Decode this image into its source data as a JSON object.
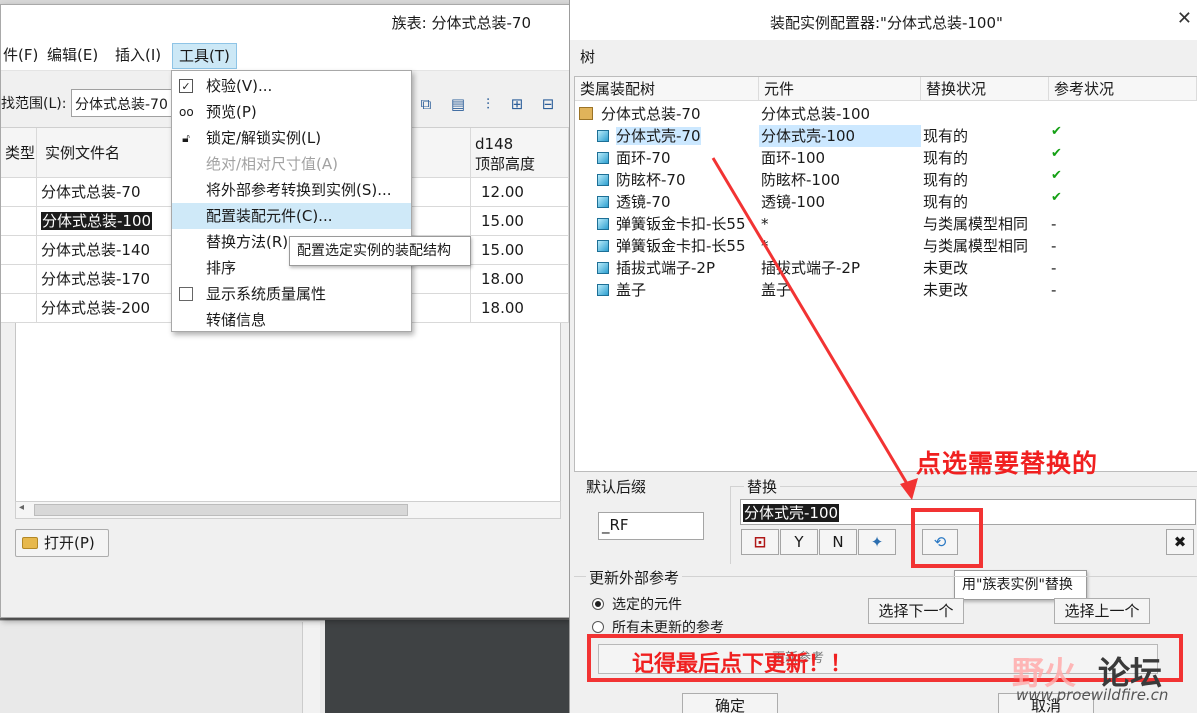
{
  "family_window": {
    "title": "族表: 分体式总装-70",
    "menu": [
      "件(F)",
      "编辑(E)",
      "插入(I)",
      "工具(T)"
    ],
    "scope_label": "找范围(L):",
    "scope_value": "分体式总装-70",
    "columns": [
      "类型",
      "实例文件名",
      "d148",
      "顶部高度"
    ],
    "rows": [
      {
        "name": "分体式总装-70",
        "value": "12.00"
      },
      {
        "name": "分体式总装-100",
        "value": "15.00"
      },
      {
        "name": "分体式总装-140",
        "value": "15.00"
      },
      {
        "name": "分体式总装-170",
        "value": "18.00"
      },
      {
        "name": "分体式总装-200",
        "value": "18.00"
      }
    ],
    "open_button": "打开(P)"
  },
  "tools_menu": {
    "items": [
      {
        "label": "校验(V)...",
        "icon": "check-box-icon"
      },
      {
        "label": "预览(P)",
        "icon": "glasses-icon"
      },
      {
        "label": "锁定/解锁实例(L)",
        "icon": "lock-icon"
      },
      {
        "label": "绝对/相对尺寸值(A)"
      },
      {
        "label": "将外部参考转换到实例(S)..."
      },
      {
        "label": "配置装配元件(C)..."
      },
      {
        "label": "替换方法(R)"
      },
      {
        "label": "排序"
      },
      {
        "label": "显示系统质量属性",
        "icon": "checkbox-icon"
      },
      {
        "label": "转储信息"
      }
    ],
    "tooltip": "配置选定实例的装配结构"
  },
  "configurator": {
    "title": "装配实例配置器:\"分体式总装-100\"",
    "tree_menu": "树",
    "columns": [
      "类属装配树",
      "元件",
      "替换状况",
      "参考状况"
    ],
    "root": {
      "name": "分体式总装-70",
      "component": "分体式总装-100"
    },
    "rows": [
      {
        "name": "分体式壳-70",
        "component": "分体式壳-100",
        "status": "现有的",
        "ref": "✔"
      },
      {
        "name": "面环-70",
        "component": "面环-100",
        "status": "现有的",
        "ref": "✔"
      },
      {
        "name": "防眩杯-70",
        "component": "防眩杯-100",
        "status": "现有的",
        "ref": "✔"
      },
      {
        "name": "透镜-70",
        "component": "透镜-100",
        "status": "现有的",
        "ref": "✔"
      },
      {
        "name": "弹簧钣金卡扣-长55",
        "component": "*",
        "status": "与类属模型相同",
        "ref": "-"
      },
      {
        "name": "弹簧钣金卡扣-长55",
        "component": "*",
        "status": "与类属模型相同",
        "ref": "-"
      },
      {
        "name": "插拔式端子-2P",
        "component": "插拔式端子-2P",
        "status": "未更改",
        "ref": "-"
      },
      {
        "name": "盖子",
        "component": "盖子",
        "status": "未更改",
        "ref": "-"
      }
    ],
    "suffix_label": "默认后缀",
    "suffix_value": "_RF",
    "replace_label": "替换",
    "replace_value": "分体式壳-100",
    "buttons": {
      "y": "Y",
      "n": "N"
    },
    "replace_tooltip": "用\"族表实例\"替换",
    "ext_ref_label": "更新外部参考",
    "radio1": "选定的元件",
    "radio2": "所有未更新的参考",
    "select_next": "选择下一个",
    "select_prev": "选择上一个",
    "update_ref": "更新参考",
    "ok": "确定",
    "cancel": "取消"
  },
  "annotations": {
    "text1": "点选需要替换的",
    "text2": "记得最后点下更新！！"
  },
  "watermark": {
    "cn1": "野火",
    "cn2": "论坛",
    "url": "www.proewildfire.cn"
  },
  "colors": {
    "annotation_red": "#f23333",
    "selection_blue": "#cce8ff",
    "check_green": "#14a014"
  }
}
